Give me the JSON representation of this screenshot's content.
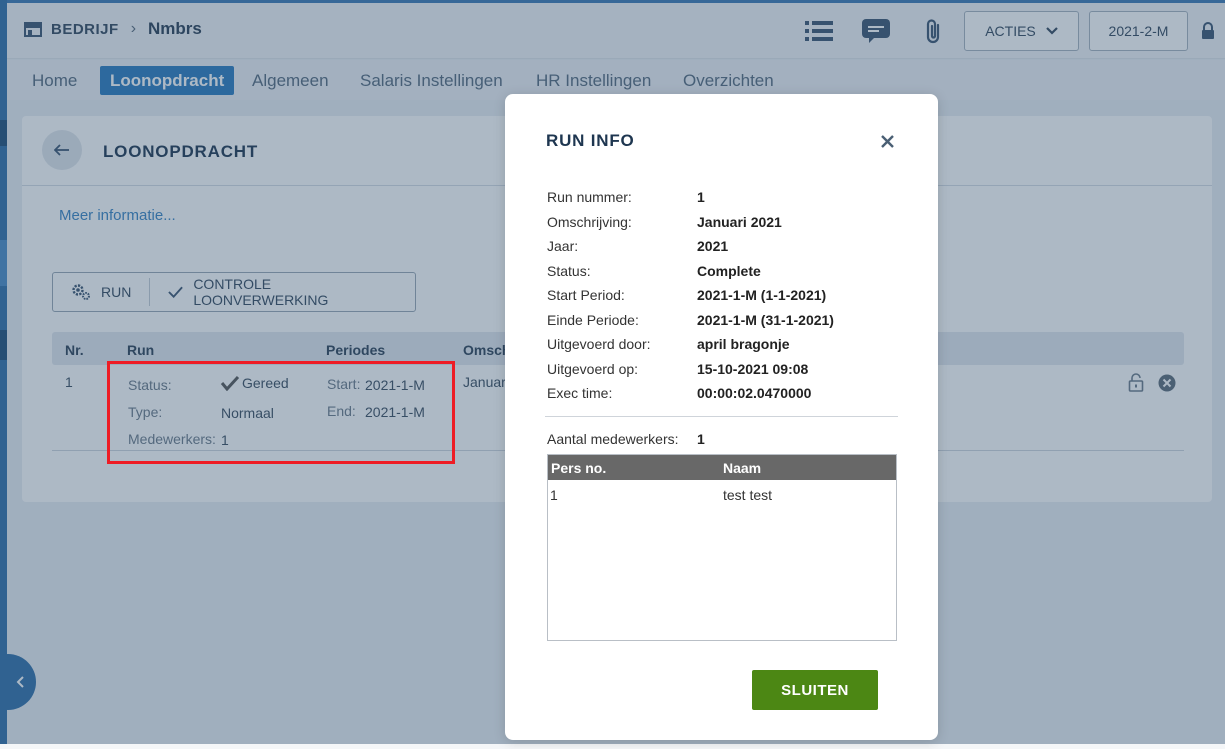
{
  "header": {
    "company": "BEDRIJF",
    "name": "Nmbrs",
    "acties_label": "ACTIES",
    "period_label": "2021-2-M"
  },
  "nav": {
    "tabs": [
      {
        "label": "Home"
      },
      {
        "label": "Loonopdracht"
      },
      {
        "label": "Algemeen"
      },
      {
        "label": "Salaris Instellingen"
      },
      {
        "label": "HR Instellingen"
      },
      {
        "label": "Overzichten"
      }
    ],
    "active_tab": "Loonopdracht"
  },
  "panel": {
    "title": "LOONOPDRACHT",
    "more_link": "Meer informatie...",
    "run_button": "RUN",
    "controle_button": "CONTROLE LOONVERWERKING",
    "table": {
      "headers": [
        "Nr.",
        "Run",
        "Periodes",
        "Omsch"
      ],
      "row": {
        "nr": "1",
        "status_label": "Status:",
        "status_value": "Gereed",
        "type_label": "Type:",
        "type_value": "Normaal",
        "medewerkers_label": "Medewerkers:",
        "medewerkers_value": "1",
        "start_label": "Start:",
        "start_value": "2021-1-M",
        "end_label": "End:",
        "end_value": "2021-1-M",
        "omschrijving": "Januar"
      }
    }
  },
  "modal": {
    "title": "RUN INFO",
    "fields": [
      {
        "label": "Run nummer:",
        "value": "1"
      },
      {
        "label": "Omschrijving:",
        "value": "Januari 2021"
      },
      {
        "label": "Jaar:",
        "value": "2021"
      },
      {
        "label": "Status:",
        "value": "Complete"
      },
      {
        "label": "Start Period:",
        "value": "2021-1-M (1-1-2021)"
      },
      {
        "label": "Einde Periode:",
        "value": "2021-1-M (31-1-2021)"
      },
      {
        "label": "Uitgevoerd door:",
        "value": "april bragonje"
      },
      {
        "label": "Uitgevoerd op:",
        "value": "15-10-2021 09:08"
      },
      {
        "label": "Exec time:",
        "value": "00:00:02.0470000"
      }
    ],
    "aantal_label": "Aantal medewerkers:",
    "aantal_value": "1",
    "table": {
      "headers": [
        "Pers no.",
        "Naam"
      ],
      "rows": [
        {
          "pers_no": "1",
          "naam": "test test"
        }
      ]
    },
    "close_button": "SLUITEN"
  },
  "colors": {
    "brand_blue": "#2b7bbf",
    "close_green": "#4c8714",
    "highlight_red": "#ee1c25"
  }
}
